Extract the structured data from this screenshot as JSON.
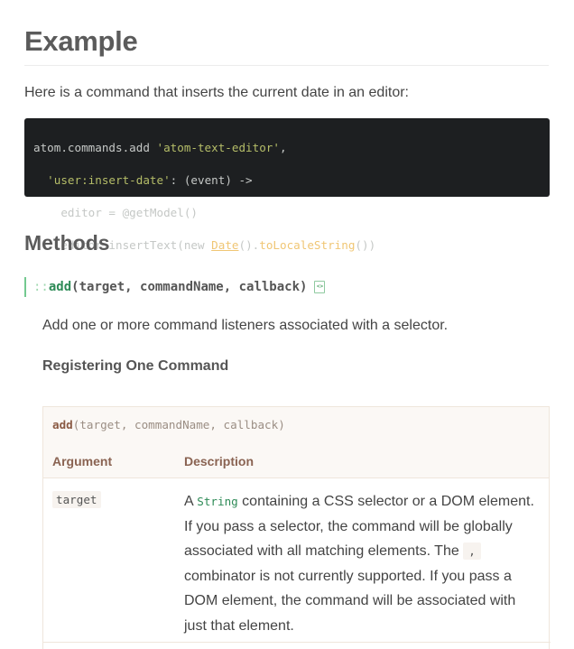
{
  "heading": "Example",
  "intro": "Here is a command that inserts the current date in an editor:",
  "code": {
    "line1_a": "atom.commands.add ",
    "line1_b": "'atom-text-editor'",
    "line1_c": ",",
    "line2_indent": "  ",
    "line2_a": "'user:insert-date'",
    "line2_b": ": (event) ->",
    "line3_indent": "    ",
    "line3_a": "editor = @getModel()",
    "line4_indent": "    ",
    "line4_a": "editor.insertText(new ",
    "line4_b": "Date",
    "line4_c": "().",
    "line4_d": "toLocaleString",
    "line4_e": "())"
  },
  "methods_heading": "Methods",
  "method": {
    "prefix": "::",
    "name": "add",
    "params": "(target, commandName, callback)",
    "source_icon": "view-source-icon",
    "description": "Add one or more command listeners associated with a selector.",
    "subheading": "Registering One Command"
  },
  "arg_table": {
    "signature_name": "add",
    "signature_params": "(target, commandName, callback)",
    "col_argument": "Argument",
    "col_description": "Description",
    "rows": [
      {
        "name": "target",
        "desc_a": "A ",
        "desc_type": "String",
        "desc_b": " containing a CSS selector or a DOM element. If you pass a selector, the command will be globally associated with all matching elements. The ",
        "desc_code": ",",
        "desc_c": " combinator is not currently supported. If you pass a DOM element, the command will be associated with just that element."
      }
    ]
  },
  "colors": {
    "accent": "#73c990",
    "code_bg": "#1d1f21",
    "code_string": "#b5bd68",
    "code_class": "#f0c674"
  }
}
